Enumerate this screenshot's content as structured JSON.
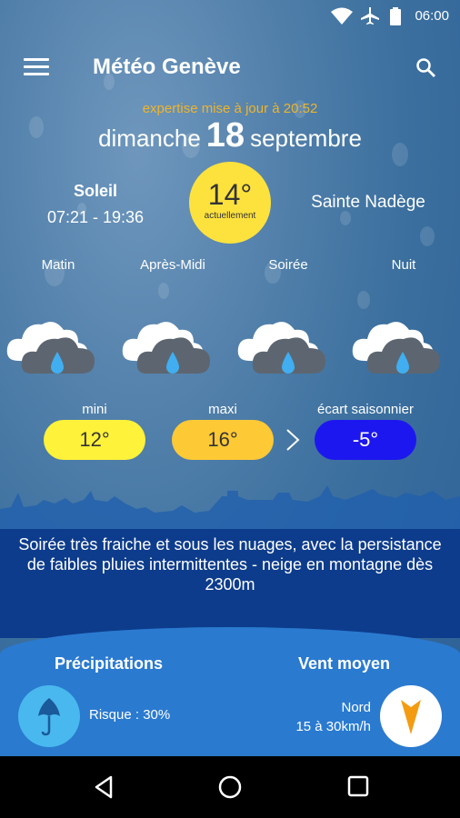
{
  "status_bar": {
    "time": "06:00"
  },
  "app_bar": {
    "title": "Météo Genève"
  },
  "update_text": "expertise mise à jour à 20:52",
  "date": {
    "weekday": "dimanche",
    "day": "18",
    "month": "septembre"
  },
  "sun": {
    "label": "Soleil",
    "hours": "07:21 - 19:36"
  },
  "current_temp": {
    "value": "14°",
    "label": "actuellement"
  },
  "saint": "Sainte Nadège",
  "periods": [
    "Matin",
    "Après-Midi",
    "Soirée",
    "Nuit"
  ],
  "period_icons": [
    "rain-cloud-icon",
    "rain-cloud-icon",
    "rain-cloud-icon",
    "rain-cloud-icon"
  ],
  "range": {
    "min_label": "mini",
    "min_value": "12°",
    "max_label": "maxi",
    "max_value": "16°",
    "gap_label": "écart saisonnier",
    "gap_value": "-5°"
  },
  "description": "Soirée très fraiche et sous les nuages, avec la persistance de faibles pluies intermittentes - neige en montagne dès 2300m",
  "precipitations": {
    "title": "Précipitations",
    "risk": "Risque : 30%"
  },
  "wind": {
    "title": "Vent moyen",
    "direction": "Nord",
    "speed": "15 à 30km/h"
  },
  "colors": {
    "min_pill": "#fff23a",
    "max_pill": "#fdc935",
    "gap_pill": "#1d17ef",
    "update_text": "#f0b429",
    "compass_arrow": "#f39c12"
  }
}
